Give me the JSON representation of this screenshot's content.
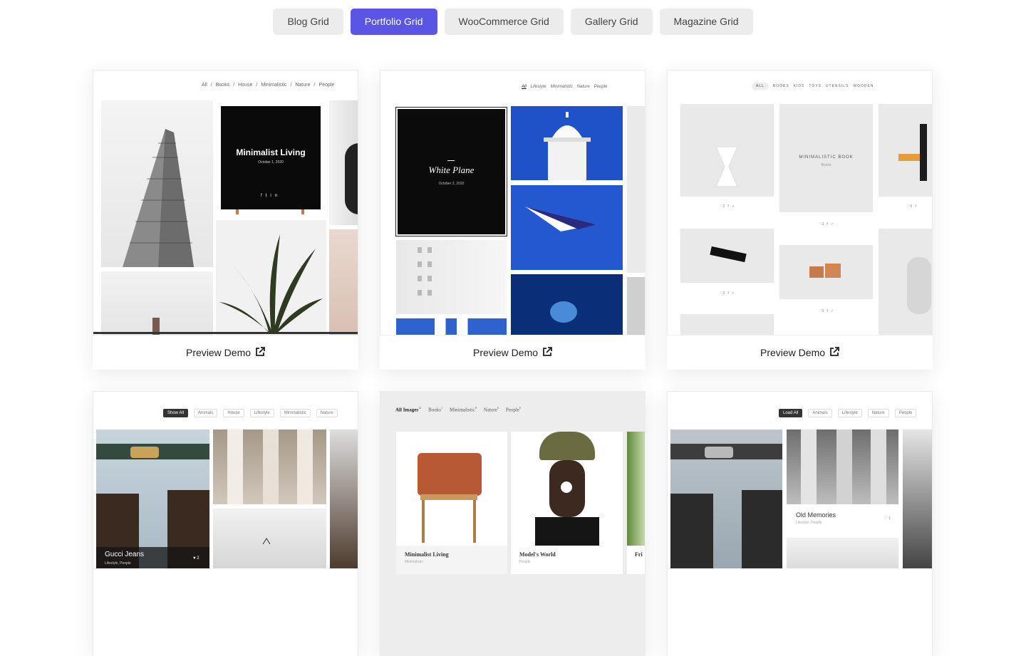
{
  "tabs": [
    {
      "label": "Blog Grid",
      "active": false
    },
    {
      "label": "Portfolio Grid",
      "active": true
    },
    {
      "label": "WooCommerce Grid",
      "active": false
    },
    {
      "label": "Gallery Grid",
      "active": false
    },
    {
      "label": "Magazine Grid",
      "active": false
    }
  ],
  "accent_color": "#5b55e6",
  "preview_label": "Preview Demo",
  "preview_icon": "external-link-icon",
  "cards": [
    {
      "nav": [
        "All",
        "/",
        "Books",
        "/",
        "House",
        "/",
        "Minimalistic",
        "/",
        "Nature",
        "/",
        "People"
      ],
      "feature_title": "Minimalist Living",
      "feature_date": "October 1, 2020",
      "social": [
        "f",
        "t",
        "in"
      ]
    },
    {
      "nav": [
        "All",
        "Lifestyle",
        "Minimalistic",
        "Nature",
        "People"
      ],
      "feature_title": "White Plane",
      "feature_date": "October 2, 2020"
    },
    {
      "nav": [
        "ALL",
        "BOOKS",
        "KIDS",
        "TOYS",
        "UTENSILS",
        "WOODEN"
      ],
      "product_title": "MINIMALISTIC BOOK",
      "product_cat": "Books",
      "likes": [
        "2",
        "3",
        "3",
        "5",
        "5"
      ]
    },
    {
      "nav": [
        "Show All",
        "Animals",
        "House",
        "Lifestyle",
        "Minimalistic",
        "Nature"
      ],
      "caption_title": "Gucci Jeans",
      "caption_meta": "Lifestyle, People",
      "caption_likes": "2"
    },
    {
      "nav": [
        {
          "label": "All Images",
          "count": "12"
        },
        {
          "label": "Books",
          "count": "1"
        },
        {
          "label": "Minimalistic",
          "count": "8"
        },
        {
          "label": "Nature",
          "count": "6"
        },
        {
          "label": "People",
          "count": "6"
        }
      ],
      "captions": [
        {
          "title": "Minimalist Living",
          "meta": "Minimalistic"
        },
        {
          "title": "Model's World",
          "meta": "People"
        },
        {
          "title": "Fri",
          "meta": ""
        }
      ]
    },
    {
      "nav": [
        "Load All",
        "Animals",
        "Lifestyle",
        "Nature",
        "People"
      ],
      "caption_title": "Old Memories",
      "caption_meta": "Lifestyle, People",
      "caption_likes": "1"
    }
  ]
}
